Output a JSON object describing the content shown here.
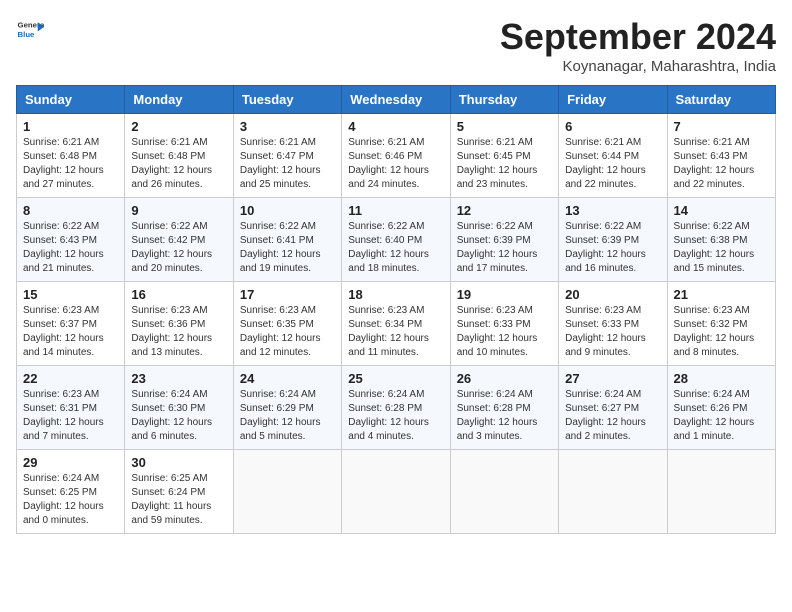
{
  "header": {
    "logo_general": "General",
    "logo_blue": "Blue",
    "month_title": "September 2024",
    "location": "Koynanagar, Maharashtra, India"
  },
  "days_of_week": [
    "Sunday",
    "Monday",
    "Tuesday",
    "Wednesday",
    "Thursday",
    "Friday",
    "Saturday"
  ],
  "weeks": [
    [
      {
        "day": "1",
        "sunrise": "6:21 AM",
        "sunset": "6:48 PM",
        "daylight": "12 hours and 27 minutes."
      },
      {
        "day": "2",
        "sunrise": "6:21 AM",
        "sunset": "6:48 PM",
        "daylight": "12 hours and 26 minutes."
      },
      {
        "day": "3",
        "sunrise": "6:21 AM",
        "sunset": "6:47 PM",
        "daylight": "12 hours and 25 minutes."
      },
      {
        "day": "4",
        "sunrise": "6:21 AM",
        "sunset": "6:46 PM",
        "daylight": "12 hours and 24 minutes."
      },
      {
        "day": "5",
        "sunrise": "6:21 AM",
        "sunset": "6:45 PM",
        "daylight": "12 hours and 23 minutes."
      },
      {
        "day": "6",
        "sunrise": "6:21 AM",
        "sunset": "6:44 PM",
        "daylight": "12 hours and 22 minutes."
      },
      {
        "day": "7",
        "sunrise": "6:21 AM",
        "sunset": "6:43 PM",
        "daylight": "12 hours and 22 minutes."
      }
    ],
    [
      {
        "day": "8",
        "sunrise": "6:22 AM",
        "sunset": "6:43 PM",
        "daylight": "12 hours and 21 minutes."
      },
      {
        "day": "9",
        "sunrise": "6:22 AM",
        "sunset": "6:42 PM",
        "daylight": "12 hours and 20 minutes."
      },
      {
        "day": "10",
        "sunrise": "6:22 AM",
        "sunset": "6:41 PM",
        "daylight": "12 hours and 19 minutes."
      },
      {
        "day": "11",
        "sunrise": "6:22 AM",
        "sunset": "6:40 PM",
        "daylight": "12 hours and 18 minutes."
      },
      {
        "day": "12",
        "sunrise": "6:22 AM",
        "sunset": "6:39 PM",
        "daylight": "12 hours and 17 minutes."
      },
      {
        "day": "13",
        "sunrise": "6:22 AM",
        "sunset": "6:39 PM",
        "daylight": "12 hours and 16 minutes."
      },
      {
        "day": "14",
        "sunrise": "6:22 AM",
        "sunset": "6:38 PM",
        "daylight": "12 hours and 15 minutes."
      }
    ],
    [
      {
        "day": "15",
        "sunrise": "6:23 AM",
        "sunset": "6:37 PM",
        "daylight": "12 hours and 14 minutes."
      },
      {
        "day": "16",
        "sunrise": "6:23 AM",
        "sunset": "6:36 PM",
        "daylight": "12 hours and 13 minutes."
      },
      {
        "day": "17",
        "sunrise": "6:23 AM",
        "sunset": "6:35 PM",
        "daylight": "12 hours and 12 minutes."
      },
      {
        "day": "18",
        "sunrise": "6:23 AM",
        "sunset": "6:34 PM",
        "daylight": "12 hours and 11 minutes."
      },
      {
        "day": "19",
        "sunrise": "6:23 AM",
        "sunset": "6:33 PM",
        "daylight": "12 hours and 10 minutes."
      },
      {
        "day": "20",
        "sunrise": "6:23 AM",
        "sunset": "6:33 PM",
        "daylight": "12 hours and 9 minutes."
      },
      {
        "day": "21",
        "sunrise": "6:23 AM",
        "sunset": "6:32 PM",
        "daylight": "12 hours and 8 minutes."
      }
    ],
    [
      {
        "day": "22",
        "sunrise": "6:23 AM",
        "sunset": "6:31 PM",
        "daylight": "12 hours and 7 minutes."
      },
      {
        "day": "23",
        "sunrise": "6:24 AM",
        "sunset": "6:30 PM",
        "daylight": "12 hours and 6 minutes."
      },
      {
        "day": "24",
        "sunrise": "6:24 AM",
        "sunset": "6:29 PM",
        "daylight": "12 hours and 5 minutes."
      },
      {
        "day": "25",
        "sunrise": "6:24 AM",
        "sunset": "6:28 PM",
        "daylight": "12 hours and 4 minutes."
      },
      {
        "day": "26",
        "sunrise": "6:24 AM",
        "sunset": "6:28 PM",
        "daylight": "12 hours and 3 minutes."
      },
      {
        "day": "27",
        "sunrise": "6:24 AM",
        "sunset": "6:27 PM",
        "daylight": "12 hours and 2 minutes."
      },
      {
        "day": "28",
        "sunrise": "6:24 AM",
        "sunset": "6:26 PM",
        "daylight": "12 hours and 1 minute."
      }
    ],
    [
      {
        "day": "29",
        "sunrise": "6:24 AM",
        "sunset": "6:25 PM",
        "daylight": "12 hours and 0 minutes."
      },
      {
        "day": "30",
        "sunrise": "6:25 AM",
        "sunset": "6:24 PM",
        "daylight": "11 hours and 59 minutes."
      },
      null,
      null,
      null,
      null,
      null
    ]
  ]
}
